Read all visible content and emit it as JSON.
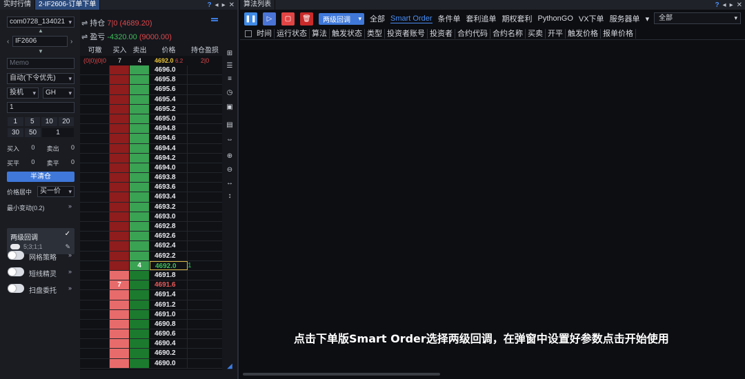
{
  "left_tabs": [
    "实时行情",
    "2-IF2606-订单下单"
  ],
  "right_tabs": [
    "算法列表"
  ],
  "win_controls": [
    "?",
    "◂",
    "▸",
    "✕"
  ],
  "form": {
    "account": "com0728_134021",
    "symbol": "IF2606",
    "memo_placeholder": "Memo",
    "mode": "自动(下令优先)",
    "order_type": "投机",
    "exchange": "GH",
    "quantity": "1",
    "qty_presets": [
      "1",
      "5",
      "10",
      "20"
    ],
    "qty_presets2": [
      "30",
      "50",
      "1"
    ],
    "stats": [
      {
        "l1": "买入",
        "v1": "0",
        "l2": "卖出",
        "v2": "0"
      },
      {
        "l1": "买平",
        "v1": "0",
        "l2": "卖平",
        "v2": "0"
      }
    ],
    "close_all_button": "半清仓",
    "price_label": "价格居中",
    "price_mode": "买一价",
    "min_move": "最小变动(0.2)",
    "two_level_title": "两级回调",
    "two_level_sub": "5;3;1;1",
    "toggles": [
      "网格策略",
      "短线精灵",
      "扫盘委托"
    ]
  },
  "summary": {
    "hold_label": "持仓",
    "hold_qty": "7|0",
    "hold_price": "(4689.20)",
    "profit_label": "盈亏",
    "profit_value": "-4320.00",
    "profit_extra": "(9000.00)"
  },
  "ladder": {
    "headers": [
      "可撤",
      "买入",
      "卖出",
      "价格",
      "持仓盈损"
    ],
    "stat_left": "(0|0)|0|0",
    "stat_buy": "7",
    "stat_sell": "4",
    "stat_price": "4692.0",
    "stat_chg": "6.2",
    "stat_hold": "2|0",
    "rows": [
      {
        "price": "4696.0",
        "buy": "",
        "sell": "",
        "hold": ""
      },
      {
        "price": "4695.8",
        "buy": "",
        "sell": "",
        "hold": ""
      },
      {
        "price": "4695.6",
        "buy": "",
        "sell": "",
        "hold": ""
      },
      {
        "price": "4695.4",
        "buy": "",
        "sell": "",
        "hold": ""
      },
      {
        "price": "4695.2",
        "buy": "",
        "sell": "",
        "hold": ""
      },
      {
        "price": "4695.0",
        "buy": "",
        "sell": "",
        "hold": ""
      },
      {
        "price": "4694.8",
        "buy": "",
        "sell": "",
        "hold": ""
      },
      {
        "price": "4694.6",
        "buy": "",
        "sell": "",
        "hold": ""
      },
      {
        "price": "4694.4",
        "buy": "",
        "sell": "",
        "hold": ""
      },
      {
        "price": "4694.2",
        "buy": "",
        "sell": "",
        "hold": ""
      },
      {
        "price": "4694.0",
        "buy": "",
        "sell": "",
        "hold": ""
      },
      {
        "price": "4693.8",
        "buy": "",
        "sell": "",
        "hold": ""
      },
      {
        "price": "4693.6",
        "buy": "",
        "sell": "",
        "hold": ""
      },
      {
        "price": "4693.4",
        "buy": "",
        "sell": "",
        "hold": ""
      },
      {
        "price": "4693.2",
        "buy": "",
        "sell": "",
        "hold": ""
      },
      {
        "price": "4693.0",
        "buy": "",
        "sell": "",
        "hold": ""
      },
      {
        "price": "4692.8",
        "buy": "",
        "sell": "",
        "hold": ""
      },
      {
        "price": "4692.6",
        "buy": "",
        "sell": "",
        "hold": ""
      },
      {
        "price": "4692.4",
        "buy": "",
        "sell": "",
        "hold": ""
      },
      {
        "price": "4692.2",
        "buy": "",
        "sell": "",
        "hold": ""
      },
      {
        "price": "4692.0",
        "buy": "",
        "sell": "4",
        "hold": "1"
      },
      {
        "price": "4691.8",
        "buy": "",
        "sell": "",
        "hold": ""
      },
      {
        "price": "4691.6",
        "buy": "7",
        "sell": "",
        "hold": ""
      },
      {
        "price": "4691.4",
        "buy": "",
        "sell": "",
        "hold": ""
      },
      {
        "price": "4691.2",
        "buy": "",
        "sell": "",
        "hold": ""
      },
      {
        "price": "4691.0",
        "buy": "",
        "sell": "",
        "hold": ""
      },
      {
        "price": "4690.8",
        "buy": "",
        "sell": "",
        "hold": ""
      },
      {
        "price": "4690.6",
        "buy": "",
        "sell": "",
        "hold": ""
      },
      {
        "price": "4690.4",
        "buy": "",
        "sell": "",
        "hold": ""
      },
      {
        "price": "4690.2",
        "buy": "",
        "sell": "",
        "hold": ""
      },
      {
        "price": "4690.0",
        "buy": "",
        "sell": "",
        "hold": ""
      }
    ]
  },
  "toolbar": {
    "algo_button": "两级回调",
    "links": [
      "全部",
      "Smart Order",
      "条件单",
      "套利追单",
      "期权套利",
      "PythonGO",
      "VX下单",
      "服务器单"
    ],
    "active_link": "Smart Order",
    "filter_value": "全部"
  },
  "table_headers": [
    "时间",
    "运行状态",
    "算法",
    "触发状态",
    "类型",
    "投资者账号",
    "投资者",
    "合约代码",
    "合约名称",
    "买卖",
    "开平",
    "触发价格",
    "报单价格"
  ],
  "caption": "点击下单版Smart Order选择两级回调，在弹窗中设置好参数点击开始使用",
  "colors": {
    "buy": "#8f1d1d",
    "sell": "#3aa253",
    "accent": "#3f78d9"
  }
}
